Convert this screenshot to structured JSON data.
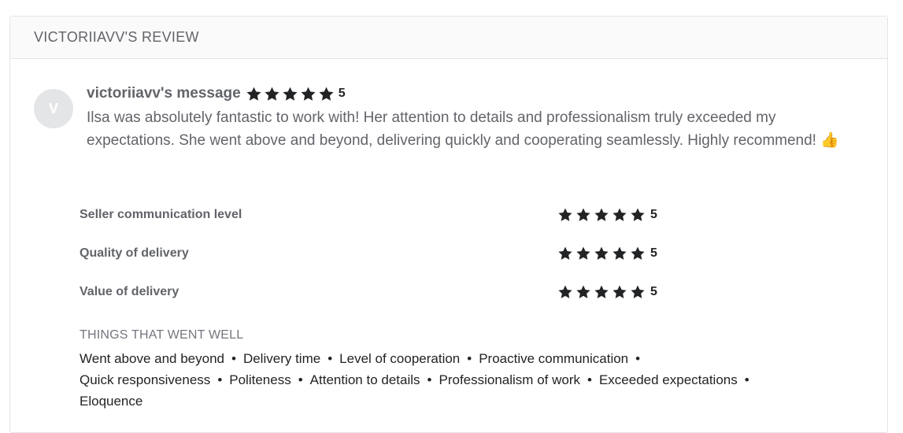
{
  "header": {
    "title": "VICTORIIAVV'S REVIEW"
  },
  "message": {
    "avatar_initial": "V",
    "author": "victoriiavv's message",
    "rating": "5",
    "rating_value": 5,
    "text": "Ilsa was absolutely fantastic to work with! Her attention to details and professionalism truly exceeded my expectations. She went above and beyond, delivering quickly and cooperating seamlessly. Highly recommend! 👍"
  },
  "ratings": [
    {
      "label": "Seller communication level",
      "score": "5",
      "value": 5
    },
    {
      "label": "Quality of delivery",
      "score": "5",
      "value": 5
    },
    {
      "label": "Value of delivery",
      "score": "5",
      "value": 5
    }
  ],
  "went_well": {
    "title": "THINGS THAT WENT WELL",
    "items": [
      "Went above and beyond",
      "Delivery time",
      "Level of cooperation",
      "Proactive communication",
      "Quick responsiveness",
      "Politeness",
      "Attention to details",
      "Professionalism of work",
      "Exceeded expectations",
      "Eloquence"
    ]
  },
  "colors": {
    "star": "#222325",
    "text": "#62646a",
    "border": "#e4e5e7"
  },
  "icons": {
    "rating": "star-icon"
  }
}
